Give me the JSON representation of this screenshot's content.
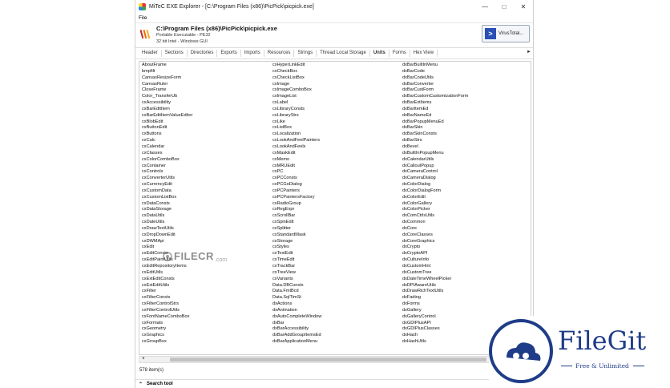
{
  "window": {
    "title": "MiTeC EXE Explorer - [C:\\Program Files (x86)\\PicPick\\picpick.exe]",
    "controls": [
      "—",
      "□",
      "✕"
    ]
  },
  "menu": {
    "file": "File"
  },
  "header": {
    "path": "C:\\Program Files (x86)\\PicPick\\picpick.exe",
    "type": "Portable Executable - PE32",
    "arch": "32 bit Intel - Windows GUI",
    "virustotal_label": "VirusTotal..."
  },
  "tabs": [
    "Header",
    "Sections",
    "Directories",
    "Exports",
    "Imports",
    "Resources",
    "Strings",
    "Thread Local Storage",
    "Units",
    "Forms",
    "Hex View"
  ],
  "active_tab": "Units",
  "units": {
    "col1": [
      "AboutFrame",
      "bmpfilt",
      "CanvasResizeForm",
      "CanvasRuler",
      "CloseFrame",
      "Color_TransferUb",
      "cxAccessibility",
      "cxBarEditItem",
      "cxBarEditItemValueEditor",
      "cxBlobEdit",
      "cxButtonEdit",
      "cxButtons",
      "cxCalc",
      "cxCalendar",
      "cxClasses",
      "cxColorComboBox",
      "cxContainer",
      "cxControls",
      "cxConverterUtils",
      "cxCurrencyEdit",
      "cxCustomData",
      "cxCustomListBox",
      "cxDataConsts",
      "cxDataStorage",
      "cxDataUtils",
      "cxDateUtils",
      "cxDrawTextUtils",
      "cxDropDownEdit",
      "cxDWMApi",
      "cxEdit",
      "cxEditConsts",
      "cxEditPaintUtils",
      "cxEditRepositoryItems",
      "cxEditUtils",
      "cxExtEditConsts",
      "cxExtEditUtils",
      "cxFilter",
      "cxFilterConsts",
      "cxFilterControlStrs",
      "cxFilterControlUtils",
      "cxFontNameComboBox",
      "cxFormats",
      "cxGeometry",
      "cxGraphics",
      "cxGroupBox"
    ],
    "col2": [
      "cxHyperLinkEdit",
      "cxCheckBox",
      "cxCheckListBox",
      "cxImage",
      "cxImageComboBox",
      "cxImageList",
      "cxLabel",
      "cxLibraryConsts",
      "cxLibraryStrs",
      "cxLike",
      "cxListBox",
      "cxLocalization",
      "cxLookAndFeelPainters",
      "cxLookAndFeels",
      "cxMaskEdit",
      "cxMemo",
      "cxMRUEdit",
      "cxPC",
      "cxPCConsts",
      "cxPCGoDialog",
      "cxPCPainters",
      "cxPCPaintersFactory",
      "cxRadioGroup",
      "cxRegExpr",
      "cxScrollBar",
      "cxSpinEdit",
      "cxSplitter",
      "cxStandardMask",
      "cxStorage",
      "cxStyles",
      "cxTextEdit",
      "cxTimeEdit",
      "cxTrackBar",
      "cxTreeView",
      "cxVariants",
      "Data.DBConsts",
      "Data.FmtBcd",
      "Data.SqlTimSt",
      "dxActions",
      "dxAnimation",
      "dxAutoCompleteWindow",
      "dxBar",
      "dxBarAccessibility",
      "dxBarAddGroupItemsEd",
      "dxBarApplicationMenu"
    ],
    "col3": [
      "dxBarBuiltInMenu",
      "dxBarCode",
      "dxBarCodeUtils",
      "dxBarConverter",
      "dxBarCustForm",
      "dxBarCustomCustomizationForm",
      "dxBarExtItems",
      "dxBarItemEd",
      "dxBarNameEd",
      "dxBarPopupMenuEd",
      "dxBarSkin",
      "dxBarSkinConsts",
      "dxBarStrs",
      "dxBevel",
      "dxBuiltInPopupMenu",
      "dxCalendarUtils",
      "dxCalloutPopup",
      "dxCameraControl",
      "dxCameraDialog",
      "dxColorDialog",
      "dxColorDialogForm",
      "dxColorEdit",
      "dxColorGallery",
      "dxColorPicker",
      "dxComCtrlsUtils",
      "dxCommon",
      "dxCore",
      "dxCoreClasses",
      "dxCoreGraphics",
      "dxCrypto",
      "dxCryptoAPI",
      "dxCultureInfo",
      "dxCustomHint",
      "dxCustomTree",
      "dxDateTimeWheelPicker",
      "dxDPIAwareUtils",
      "dxDrawRichTextUtils",
      "dxFading",
      "dxForms",
      "dxGallery",
      "dxGalleryControl",
      "dxGDIPlusAPI",
      "dxGDIPlusClasses",
      "dxHash",
      "dxHashUtils"
    ]
  },
  "status": "578 item(s)",
  "search_tool": "Search tool",
  "watermarks": {
    "filecr_main": "FILECR",
    "filecr_suffix": ".com",
    "filegit_name": "FileGit",
    "filegit_tag": "Free & Unlimited"
  }
}
